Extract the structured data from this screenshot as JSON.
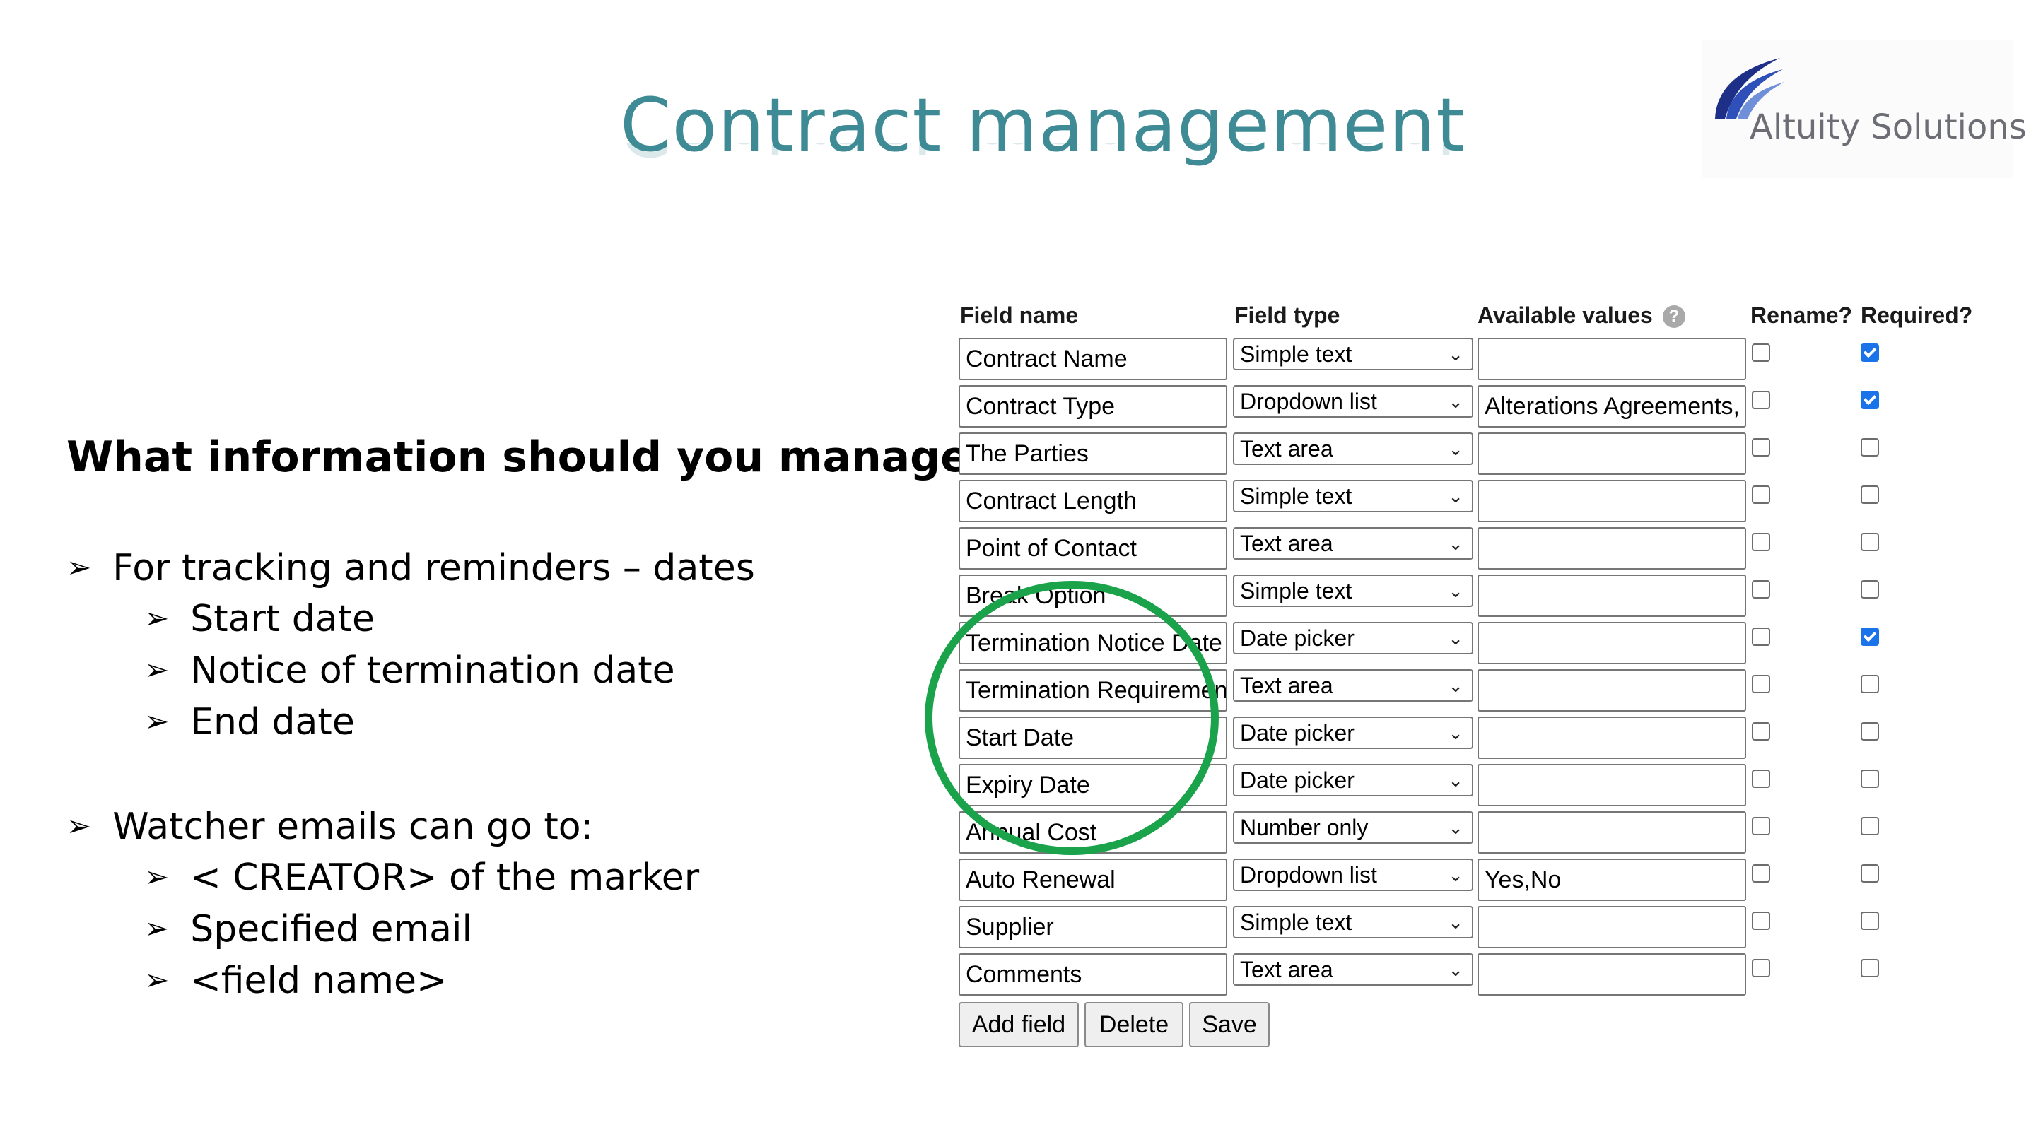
{
  "slide": {
    "title": "Contract management",
    "logo": {
      "text": "Altuity Solutions",
      "icon": "swoosh-logo-icon"
    },
    "question": "What information should you manage?",
    "bullets": [
      {
        "text": "For tracking and reminders – dates",
        "sub": [
          "Start date",
          "Notice of termination date",
          "End date"
        ]
      },
      {
        "text": "Watcher emails can go to:",
        "sub": [
          "< CREATOR> of the marker",
          "Specified email",
          "<field name>"
        ]
      }
    ]
  },
  "form": {
    "headers": {
      "field_name": "Field name",
      "field_type": "Field type",
      "available_values": "Available values",
      "rename": "Rename?",
      "required": "Required?"
    },
    "rows": [
      {
        "name": "Contract Name",
        "type": "Simple text",
        "values": "",
        "rename": false,
        "required": true
      },
      {
        "name": "Contract Type",
        "type": "Dropdown list",
        "values": "Alterations Agreements,",
        "rename": false,
        "required": true
      },
      {
        "name": "The Parties",
        "type": "Text area",
        "values": "",
        "rename": false,
        "required": false
      },
      {
        "name": "Contract Length",
        "type": "Simple text",
        "values": "",
        "rename": false,
        "required": false
      },
      {
        "name": "Point of Contact",
        "type": "Text area",
        "values": "",
        "rename": false,
        "required": false
      },
      {
        "name": "Break Option",
        "type": "Simple text",
        "values": "",
        "rename": false,
        "required": false
      },
      {
        "name": "Termination Notice Date",
        "type": "Date picker",
        "values": "",
        "rename": false,
        "required": true
      },
      {
        "name": "Termination Requirement",
        "type": "Text area",
        "values": "",
        "rename": false,
        "required": false
      },
      {
        "name": "Start Date",
        "type": "Date picker",
        "values": "",
        "rename": false,
        "required": false
      },
      {
        "name": "Expiry Date",
        "type": "Date picker",
        "values": "",
        "rename": false,
        "required": false
      },
      {
        "name": "Annual Cost",
        "type": "Number only",
        "values": "",
        "rename": false,
        "required": false
      },
      {
        "name": "Auto Renewal",
        "type": "Dropdown list",
        "values": "Yes,No",
        "rename": false,
        "required": false
      },
      {
        "name": "Supplier",
        "type": "Simple text",
        "values": "",
        "rename": false,
        "required": false
      },
      {
        "name": "Comments",
        "type": "Text area",
        "values": "",
        "rename": false,
        "required": false
      }
    ],
    "buttons": {
      "add": "Add field",
      "delete": "Delete",
      "save": "Save"
    },
    "help_glyph": "?"
  },
  "colors": {
    "title": "#3f8b95",
    "highlight_circle": "#1aa34a",
    "checkbox_checked": "#1a73e8"
  }
}
